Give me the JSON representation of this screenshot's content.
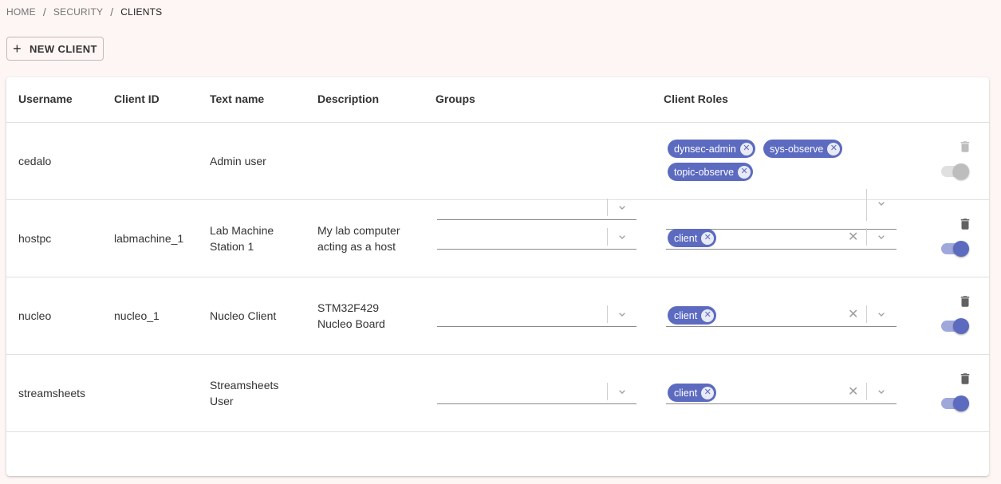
{
  "breadcrumb": {
    "items": [
      "HOME",
      "SECURITY",
      "CLIENTS"
    ],
    "separator": "/"
  },
  "toolbar": {
    "new_client_label": "NEW CLIENT"
  },
  "table": {
    "headers": {
      "username": "Username",
      "client_id": "Client ID",
      "text_name": "Text name",
      "description": "Description",
      "groups": "Groups",
      "client_roles": "Client Roles"
    },
    "rows": [
      {
        "username": "cedalo",
        "client_id": "",
        "text_name": "Admin user",
        "description": "",
        "roles": [
          "dynsec-admin",
          "sys-observe",
          "topic-observe"
        ],
        "enabled": true,
        "deletable": false
      },
      {
        "username": "hostpc",
        "client_id": "labmachine_1",
        "text_name": "Lab Machine Station 1",
        "description": "My lab computer acting as a host",
        "roles": [
          "client"
        ],
        "enabled": true,
        "deletable": true
      },
      {
        "username": "nucleo",
        "client_id": "nucleo_1",
        "text_name": "Nucleo Client",
        "description": "STM32F429 Nucleo Board",
        "roles": [
          "client"
        ],
        "enabled": true,
        "deletable": true
      },
      {
        "username": "streamsheets",
        "client_id": "",
        "text_name": "Streamsheets User",
        "description": "",
        "roles": [
          "client"
        ],
        "enabled": true,
        "deletable": true
      }
    ]
  },
  "icons": {
    "plus": "plus-icon",
    "chip_remove": "cancel-circle-icon",
    "dropdown": "chevron-down-icon",
    "clear": "close-icon",
    "delete": "trash-icon"
  },
  "colors": {
    "accent": "#5c6bc0",
    "background": "#fdf6f4",
    "toggle_disabled_thumb": "#bdbdbd",
    "trash_active": "#616161",
    "trash_disabled": "#bdbdbd"
  }
}
